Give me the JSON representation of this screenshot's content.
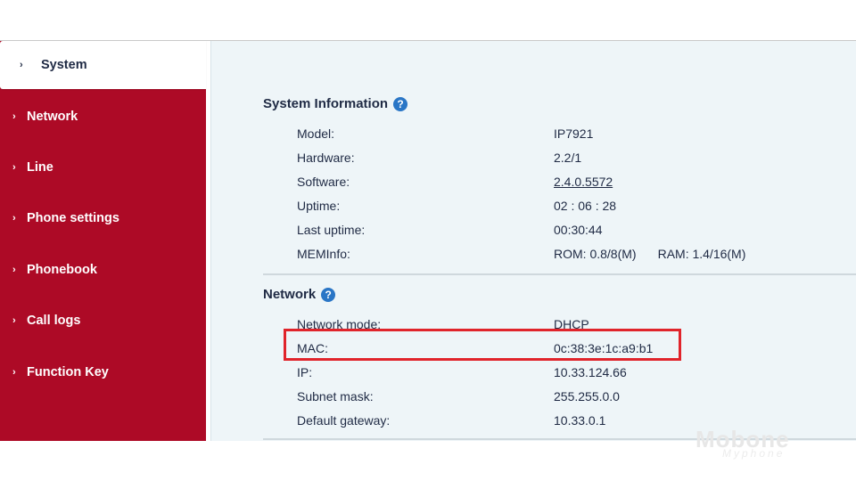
{
  "sidebar": {
    "items": [
      {
        "label": "System",
        "active": true
      },
      {
        "label": "Network"
      },
      {
        "label": "Line"
      },
      {
        "label": "Phone settings"
      },
      {
        "label": "Phonebook"
      },
      {
        "label": "Call logs"
      },
      {
        "label": "Function Key"
      }
    ]
  },
  "system_info": {
    "title": "System Information",
    "rows": [
      {
        "label": "Model:",
        "value": "IP7921"
      },
      {
        "label": "Hardware:",
        "value": "2.2/1"
      },
      {
        "label": "Software:",
        "value": "2.4.0.5572"
      },
      {
        "label": "Uptime:",
        "value": "02 : 06 : 28"
      },
      {
        "label": "Last uptime:",
        "value": "00:30:44"
      },
      {
        "label": "MEMInfo:",
        "value": "ROM: 0.8/8(M)",
        "extra": "RAM: 1.4/16(M)"
      }
    ]
  },
  "network": {
    "title": "Network",
    "rows": [
      {
        "label": "Network mode:",
        "value": "DHCP"
      },
      {
        "label": "MAC:",
        "value": "0c:38:3e:1c:a9:b1"
      },
      {
        "label": "IP:",
        "value": "10.33.124.66"
      },
      {
        "label": "Subnet mask:",
        "value": "255.255.0.0"
      },
      {
        "label": "Default gateway:",
        "value": "10.33.0.1"
      }
    ]
  },
  "icons": {
    "chevron": "›",
    "help": "?"
  },
  "colors": {
    "sidebar_bg": "#ad0a26",
    "main_bg": "#eef5f8",
    "highlight": "#e0242b",
    "help_icon": "#2a76c6"
  },
  "watermark": {
    "brand": "Mobone",
    "sub": "Myphone"
  }
}
